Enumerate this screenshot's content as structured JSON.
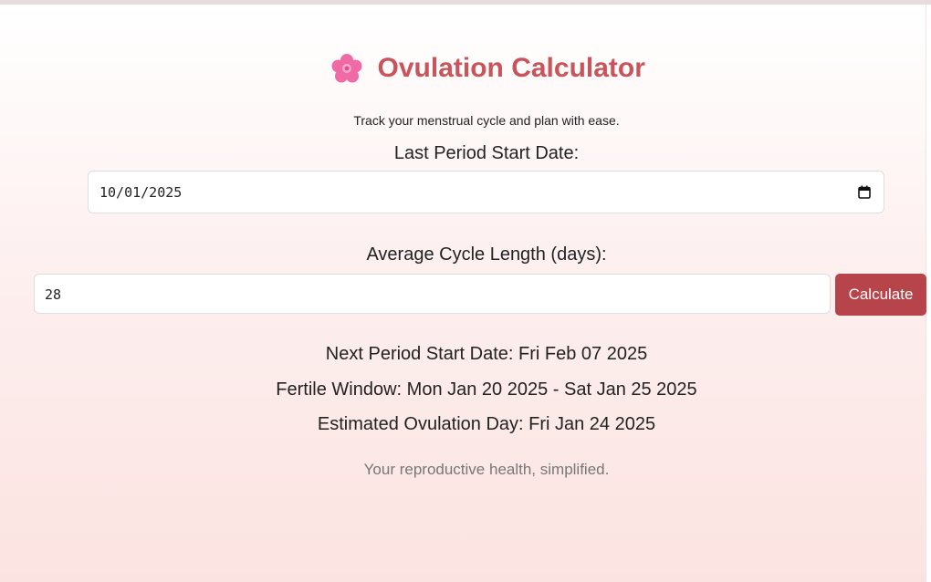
{
  "header": {
    "icon": "cherry-blossom-icon",
    "title": "Ovulation Calculator",
    "subtitle": "Track your menstrual cycle and plan with ease."
  },
  "form": {
    "date_label": "Last Period Start Date:",
    "date_value": "10/01/2025",
    "cycle_label": "Average Cycle Length (days):",
    "cycle_value": "28",
    "calculate_label": "Calculate"
  },
  "results": {
    "next_period": "Next Period Start Date: Fri Feb 07 2025",
    "fertile_window": "Fertile Window: Mon Jan 20 2025 - Sat Jan 25 2025",
    "ovulation_day": "Estimated Ovulation Day: Fri Jan 24 2025"
  },
  "footer": {
    "tagline": "Your reproductive health, simplified."
  },
  "colors": {
    "title": "#c9545c",
    "button": "#b8444b",
    "icon": "#f06aa6"
  }
}
